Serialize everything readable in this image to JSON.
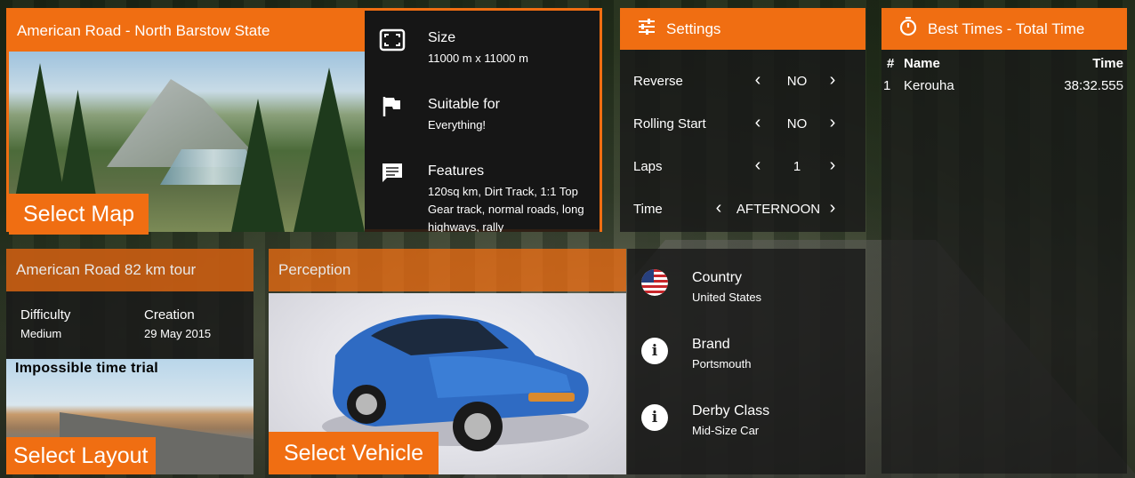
{
  "map": {
    "title": "American Road - North Barstow State",
    "select_label": "Select Map",
    "info": [
      {
        "icon": "fullscreen-frame-icon",
        "label": "Size",
        "value": "11000 m x 11000 m"
      },
      {
        "icon": "flag-icon",
        "label": "Suitable for",
        "value": "Everything!"
      },
      {
        "icon": "chat-bubble-icon",
        "label": "Features",
        "value": "120sq km, Dirt Track, 1:1 Top Gear track, normal roads, long highways, rally"
      }
    ]
  },
  "settings": {
    "title": "Settings",
    "rows": [
      {
        "label": "Reverse",
        "value": "NO"
      },
      {
        "label": "Rolling Start",
        "value": "NO"
      },
      {
        "label": "Laps",
        "value": "1"
      },
      {
        "label": "Time",
        "value": "AFTERNOON"
      }
    ]
  },
  "best_times": {
    "title": "Best Times - Total Time",
    "columns": [
      "#",
      "Name",
      "Time"
    ],
    "rows": [
      {
        "rank": "1",
        "name": "Kerouha",
        "time": "38:32.555"
      }
    ]
  },
  "layout": {
    "title": "American Road 82 km tour",
    "difficulty_label": "Difficulty",
    "difficulty_value": "Medium",
    "creation_label": "Creation",
    "creation_value": "29 May 2015",
    "image_caption": "Impossible time trial",
    "select_label": "Select Layout"
  },
  "vehicle": {
    "title": "Perception",
    "select_label": "Select Vehicle",
    "info": [
      {
        "icon": "us-flag-icon",
        "label": "Country",
        "value": "United States"
      },
      {
        "icon": "info-icon",
        "label": "Brand",
        "value": "Portsmouth"
      },
      {
        "icon": "info-icon",
        "label": "Derby Class",
        "value": "Mid-Size Car"
      }
    ]
  },
  "colors": {
    "accent": "#f06e12",
    "panel_bg": "#191919"
  }
}
